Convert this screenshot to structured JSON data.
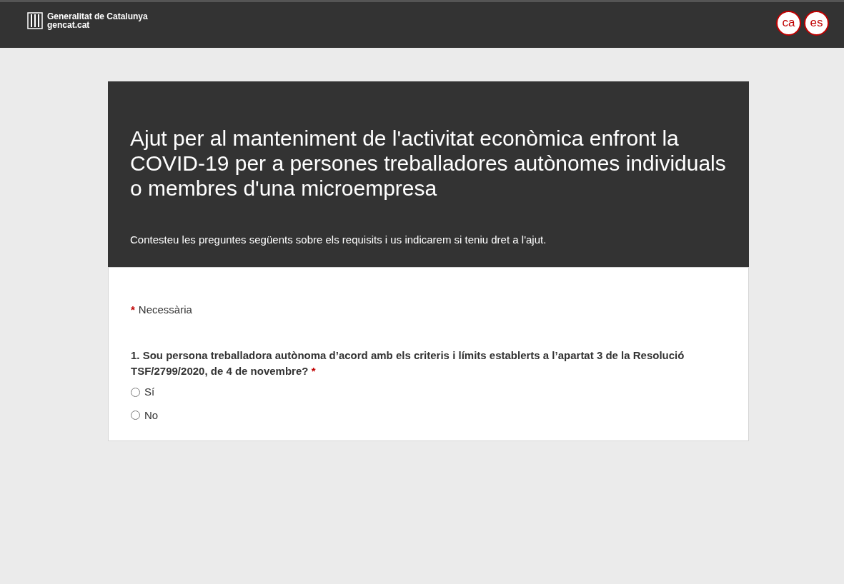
{
  "header": {
    "brand_name": "Generalitat de Catalunya",
    "brand_site": "gencat.cat",
    "languages": [
      {
        "code": "ca"
      },
      {
        "code": "es"
      }
    ]
  },
  "form": {
    "title": "Ajut per al manteniment de l'activitat econòmica enfront la COVID-19 per a persones treballadores autònomes individuals o membres d'una microempresa",
    "subtitle": "Contesteu les preguntes següents sobre els requisits i us indicarem si teniu dret a l'ajut.",
    "required_note": {
      "mark": "*",
      "text": "Necessària"
    },
    "questions": [
      {
        "text": "1. Sou persona treballadora autònoma d’acord amb els criteris i límits establerts a l’apartat 3 de la Resolució TSF/2799/2020, de 4 de novembre?",
        "required_mark": "*",
        "options": [
          {
            "label": "Sí",
            "selected": false
          },
          {
            "label": "No",
            "selected": false
          }
        ]
      }
    ]
  }
}
